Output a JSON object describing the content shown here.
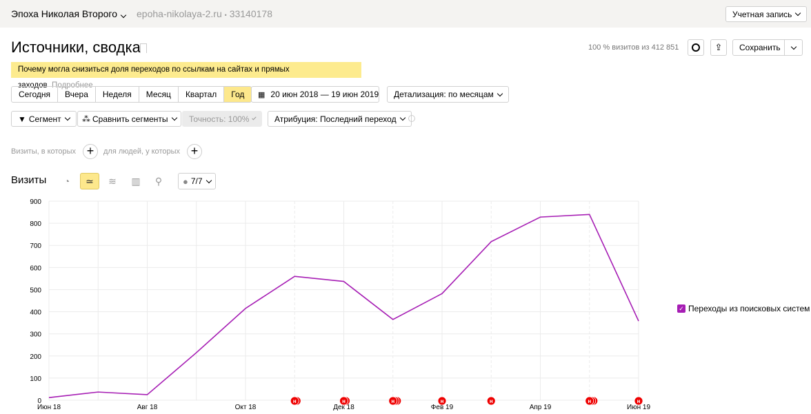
{
  "header": {
    "counter_name": "Эпоха Николая Второго",
    "site": "epoha-nikolaya-2.ru",
    "separator": "•",
    "counter_id": "33140178",
    "account_label": "Учетная запись"
  },
  "page": {
    "title": "Источники, сводка",
    "sample_info": "100 % визитов из 412 851",
    "save_label": "Сохранить"
  },
  "notice": {
    "text": "Почему могла снизиться доля переходов по ссылкам на сайтах и прямых заходов",
    "link": "Подробнее",
    "bg": "#fdeb8e"
  },
  "periods": [
    {
      "label": "Сегодня"
    },
    {
      "label": "Вчера"
    },
    {
      "label": "Неделя"
    },
    {
      "label": "Месяц"
    },
    {
      "label": "Квартал"
    },
    {
      "label": "Год",
      "active": true
    }
  ],
  "date_range": "20 июн 2018 — 19 июн 2019",
  "detail": "Детализация: по месяцам",
  "filters": {
    "segment": "Сегмент",
    "compare": "Сравнить сегменты",
    "accuracy": "Точность: 100%",
    "attribution": "Атрибуция: Последний переход"
  },
  "conditions": {
    "visits": "Визиты, в которых",
    "people": "для людей, у которых"
  },
  "chart_header": {
    "title": "Визиты",
    "annotations_count": "7/7"
  },
  "chart_data": {
    "type": "line",
    "ylim": [
      0,
      900
    ],
    "yticks": [
      0,
      100,
      200,
      300,
      400,
      500,
      600,
      700,
      800,
      900
    ],
    "xticks": [
      {
        "i": 0,
        "label": "Июн 18"
      },
      {
        "i": 2,
        "label": "Авг 18"
      },
      {
        "i": 4,
        "label": "Окт 18"
      },
      {
        "i": 6,
        "label": "Дек 18"
      },
      {
        "i": 8,
        "label": "Фев 19"
      },
      {
        "i": 10,
        "label": "Апр 19"
      },
      {
        "i": 12,
        "label": "Июн 19"
      }
    ],
    "series": [
      {
        "name": "Переходы из поисковых систем",
        "color": "#a61db4",
        "values": [
          12,
          37,
          25,
          215,
          415,
          560,
          537,
          365,
          482,
          717,
          828,
          840,
          358
        ]
      }
    ],
    "annotations": [
      {
        "i": 5,
        "count": 2
      },
      {
        "i": 6,
        "count": 2
      },
      {
        "i": 7,
        "count": 3
      },
      {
        "i": 8,
        "count": 1
      },
      {
        "i": 9,
        "count": 1
      },
      {
        "i": 11,
        "count": 3
      },
      {
        "i": 12,
        "count": 1
      }
    ],
    "annotation_glyph": "н",
    "legend": "right"
  }
}
